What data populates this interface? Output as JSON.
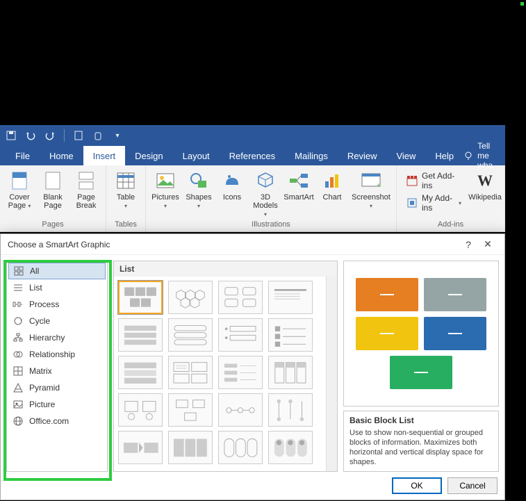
{
  "qat": {
    "tooltip_save": "Save",
    "tooltip_undo": "Undo",
    "tooltip_redo": "Redo"
  },
  "tabs": {
    "file": "File",
    "home": "Home",
    "insert": "Insert",
    "design": "Design",
    "layout": "Layout",
    "references": "References",
    "mailings": "Mailings",
    "review": "Review",
    "view": "View",
    "help": "Help",
    "tellme": "Tell me wha"
  },
  "ribbon": {
    "pages": {
      "cover": "Cover Page",
      "blank": "Blank Page",
      "break": "Page Break",
      "group": "Pages"
    },
    "tables": {
      "table": "Table",
      "group": "Tables"
    },
    "illus": {
      "pictures": "Pictures",
      "shapes": "Shapes",
      "icons": "Icons",
      "models": "3D Models",
      "smartart": "SmartArt",
      "chart": "Chart",
      "screenshot": "Screenshot",
      "group": "Illustrations"
    },
    "addins": {
      "get": "Get Add-ins",
      "my": "My Add-ins",
      "wiki": "Wikipedia",
      "group": "Add-ins"
    }
  },
  "dialog": {
    "title": "Choose a SmartArt Graphic",
    "categories": {
      "all": "All",
      "list": "List",
      "process": "Process",
      "cycle": "Cycle",
      "hierarchy": "Hierarchy",
      "relationship": "Relationship",
      "matrix": "Matrix",
      "pyramid": "Pyramid",
      "picture": "Picture",
      "office": "Office.com"
    },
    "gallery_header": "List",
    "preview": {
      "title": "Basic Block List",
      "desc": "Use to show non-sequential or grouped blocks of information. Maximizes both horizontal and vertical display space for shapes.",
      "colors": [
        "#e67e22",
        "#7f8c8d",
        "#f1c40f",
        "#2b6cb0",
        "#27ae60"
      ]
    },
    "buttons": {
      "ok": "OK",
      "cancel": "Cancel"
    }
  }
}
